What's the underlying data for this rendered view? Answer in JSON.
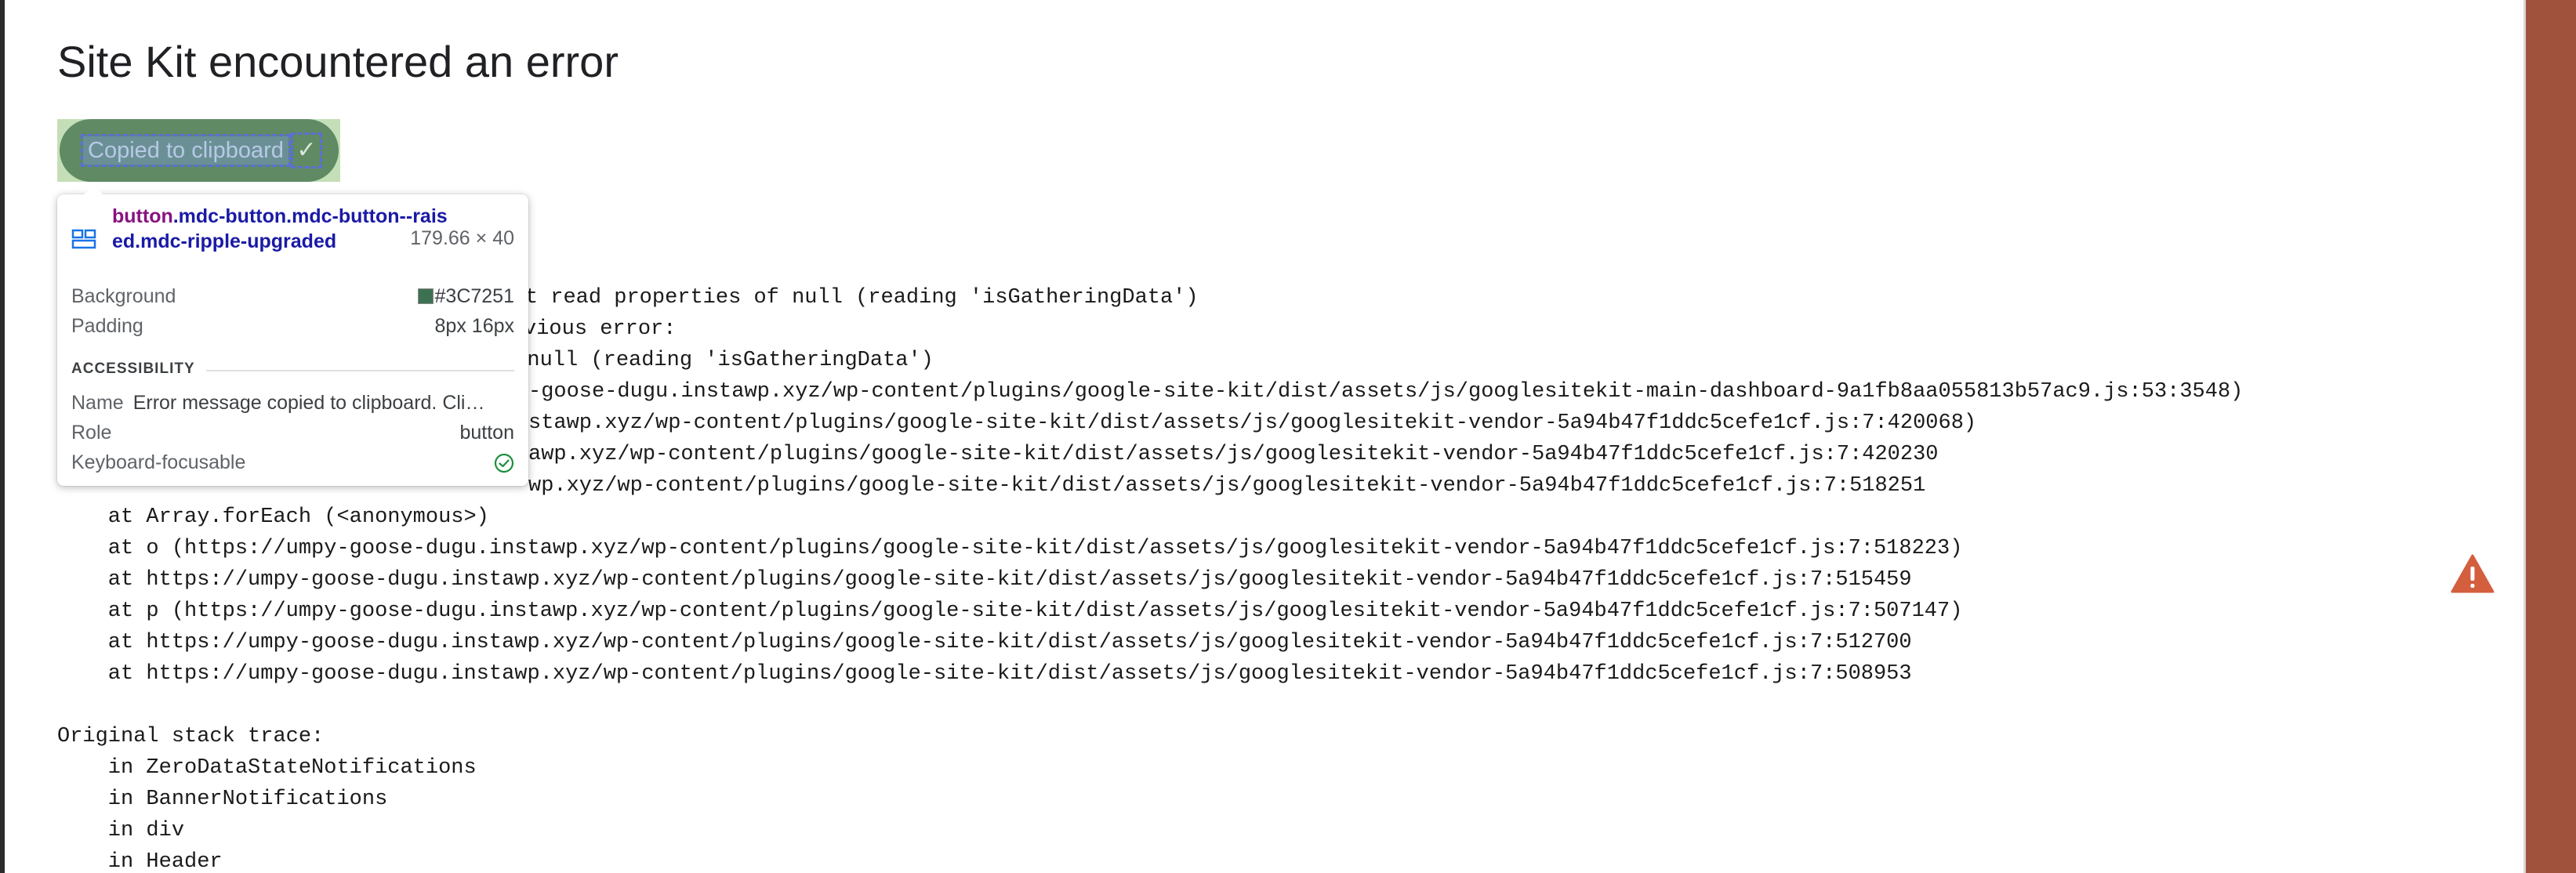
{
  "page": {
    "heading": "Site Kit encountered an error"
  },
  "copy_button": {
    "label": "Copied to clipboard",
    "icon": "check-icon",
    "icon_glyph": "✓",
    "background": "#3C7251"
  },
  "error_trace": {
    "lines": [
      "Select': Cannot read properties of null (reading 'isGatheringData')",
      "s previous error:",
      "f null (reading 'isGatheringData')",
      "-goose-dugu.instawp.xyz/wp-content/plugins/google-site-kit/dist/assets/js/googlesitekit-main-dashboard-9a1fb8aa055813b57ac9.js:53:3548)",
      "stawp.xyz/wp-content/plugins/google-site-kit/dist/assets/js/googlesitekit-vendor-5a94b47f1ddc5cefe1cf.js:7:420068)",
      "awp.xyz/wp-content/plugins/google-site-kit/dist/assets/js/googlesitekit-vendor-5a94b47f1ddc5cefe1cf.js:7:420230",
      "wp.xyz/wp-content/plugins/google-site-kit/dist/assets/js/googlesitekit-vendor-5a94b47f1ddc5cefe1cf.js:7:518251",
      "    at Array.forEach (<anonymous>)",
      "    at o (https://umpy-goose-dugu.instawp.xyz/wp-content/plugins/google-site-kit/dist/assets/js/googlesitekit-vendor-5a94b47f1ddc5cefe1cf.js:7:518223)",
      "    at https://umpy-goose-dugu.instawp.xyz/wp-content/plugins/google-site-kit/dist/assets/js/googlesitekit-vendor-5a94b47f1ddc5cefe1cf.js:7:515459",
      "    at p (https://umpy-goose-dugu.instawp.xyz/wp-content/plugins/google-site-kit/dist/assets/js/googlesitekit-vendor-5a94b47f1ddc5cefe1cf.js:7:507147)",
      "    at https://umpy-goose-dugu.instawp.xyz/wp-content/plugins/google-site-kit/dist/assets/js/googlesitekit-vendor-5a94b47f1ddc5cefe1cf.js:7:512700",
      "    at https://umpy-goose-dugu.instawp.xyz/wp-content/plugins/google-site-kit/dist/assets/js/googlesitekit-vendor-5a94b47f1ddc5cefe1cf.js:7:508953",
      "",
      "Original stack trace:",
      "    in ZeroDataStateNotifications",
      "    in BannerNotifications",
      "    in div",
      "    in Header"
    ]
  },
  "inspector_tooltip": {
    "selector_tag": "button",
    "selector_classes": ".mdc-button.mdc-button--raised.mdc-ripple-upgraded",
    "dimensions": "179.66 × 40",
    "background_label": "Background",
    "background_value": "#3C7251",
    "padding_label": "Padding",
    "padding_value": "8px 16px",
    "accessibility_title": "ACCESSIBILITY",
    "name_label": "Name",
    "name_value": "Error message copied to clipboard. Cli…",
    "role_label": "Role",
    "role_value": "button",
    "focusable_label": "Keyboard-focusable",
    "focusable_icon": "check-circle-icon"
  },
  "warning": {
    "icon": "warning-icon",
    "color": "#D35F3F"
  },
  "colors": {
    "right_strip": "#A0523D",
    "button_overlay": "#93C47D"
  }
}
